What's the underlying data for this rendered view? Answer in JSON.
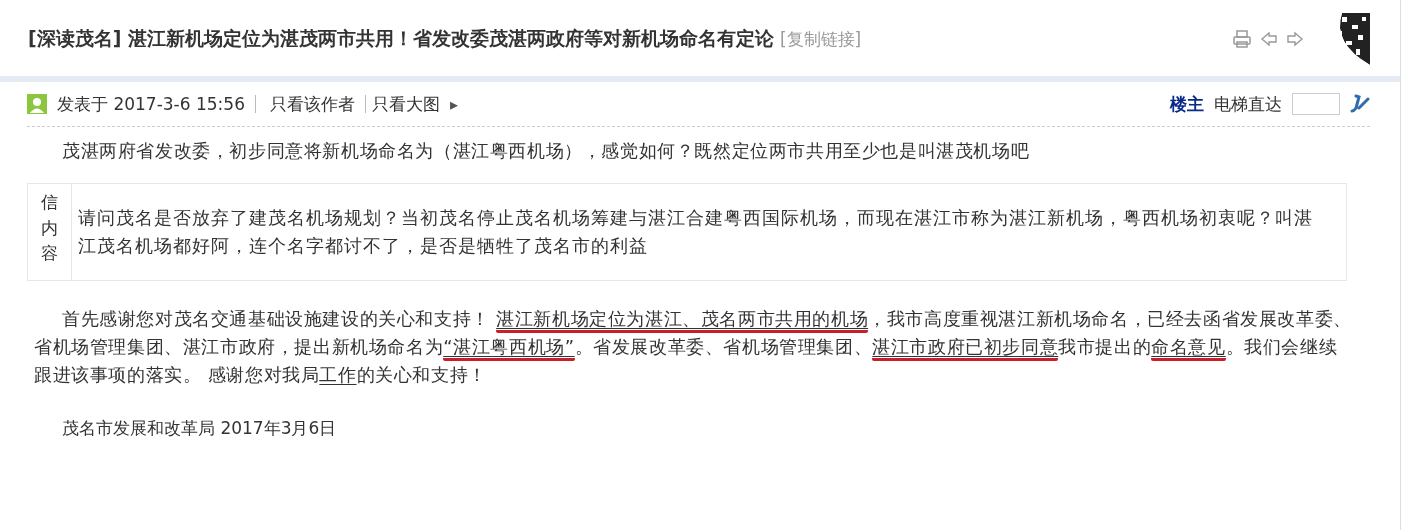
{
  "thread": {
    "tag": "[深读茂名]",
    "title": "湛江新机场定位为湛茂两市共用！省发改委茂湛两政府等对新机场命名有定论",
    "copy_link": "[复制链接]"
  },
  "post_header": {
    "posted": "发表于 2017-3-6 15:56",
    "author_only": "只看该作者",
    "big_images": "只看大图",
    "arrow": "▸",
    "floor": "楼主",
    "jump_label": "电梯直达"
  },
  "question": "茂湛两府省发改委，初步同意将新机场命名为（湛江粤西机场），感觉如何？既然定位两市共用至少也是叫湛茂机场吧",
  "letter": {
    "label": "信内容",
    "text": "请问茂名是否放弃了建茂名机场规划？当初茂名停止茂名机场筹建与湛江合建粤西国际机场，而现在湛江市称为湛江新机场，粤西机场初衷呢？叫湛江茂名机场都好阿，连个名字都讨不了，是否是牺牲了茂名市的利益"
  },
  "reply": [
    {
      "text": "首先感谢您对茂名交通基础设施建设的关心和支持！ ",
      "underlined": false,
      "red_mark": false
    },
    {
      "text": "湛江新机场定位为湛江、茂名两市共用的机场",
      "underlined": true,
      "red_mark": true
    },
    {
      "text": "，我市高度重视湛江新机场命名，已经去函省发展改革委、省机场管理集团、湛江市政府，提出新机场命名为",
      "underlined": false,
      "red_mark": false
    },
    {
      "text": "“湛江粤西机场”",
      "underlined": true,
      "red_mark": true
    },
    {
      "text": "。省发展改革委、省机场管理集团、",
      "underlined": false,
      "red_mark": false
    },
    {
      "text": "湛江市政府已初步同意",
      "underlined": true,
      "red_mark": true
    },
    {
      "text": "我市提出的",
      "underlined": false,
      "red_mark": false
    },
    {
      "text": "命名意见",
      "underlined": true,
      "red_mark": true
    },
    {
      "text": "。我们会继续跟进该事项的落实。 感谢您对我局",
      "underlined": false,
      "red_mark": false
    },
    {
      "text": "工作",
      "underlined": true,
      "red_mark": false
    },
    {
      "text": "的关心和支持！",
      "underlined": false,
      "red_mark": false
    }
  ],
  "signature": "茂名市发展和改革局 2017年3月6日"
}
